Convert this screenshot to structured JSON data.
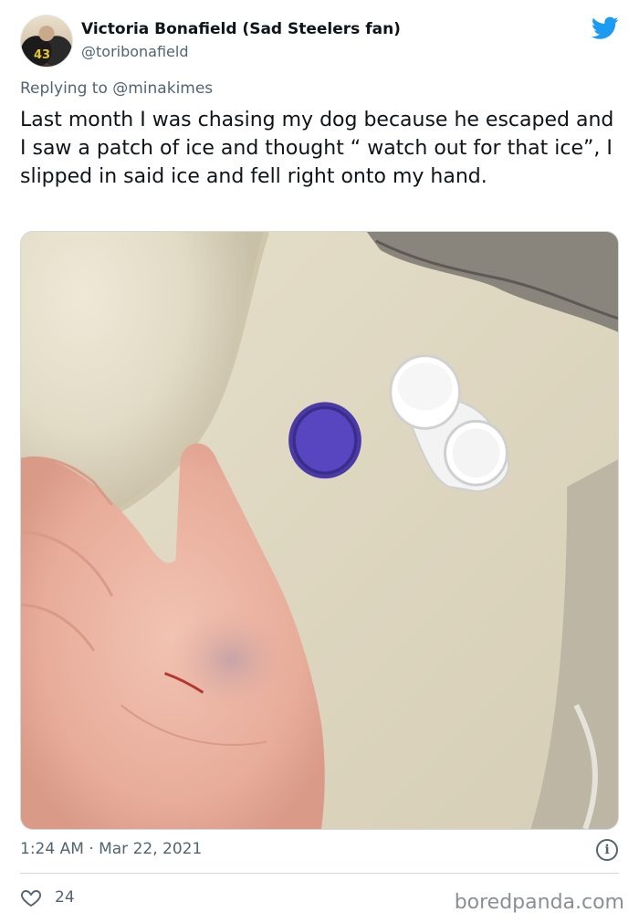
{
  "author": {
    "display_name": "Victoria Bonafield (Sad Steelers fan)",
    "handle": "@toribonafield",
    "avatar_jersey_number": "43"
  },
  "reply": {
    "prefix": "Replying to",
    "mention": "@minakimes"
  },
  "tweet": {
    "text": "Last month I was chasing my dog because he escaped and I saw a patch of ice and thought “ watch out for that ice”, I slipped in said ice and fell right onto my hand.",
    "timestamp": "1:24 AM · Mar 22, 2021",
    "like_count": "24"
  },
  "watermark": "boredpanda.com",
  "colors": {
    "twitter_blue": "#1d9bf0",
    "muted_text": "#536471",
    "primary_text": "#0f1419",
    "divider": "#cfd9de"
  },
  "icons": {
    "brand": "twitter-bird-icon",
    "info": "info-icon",
    "like": "heart-icon"
  }
}
